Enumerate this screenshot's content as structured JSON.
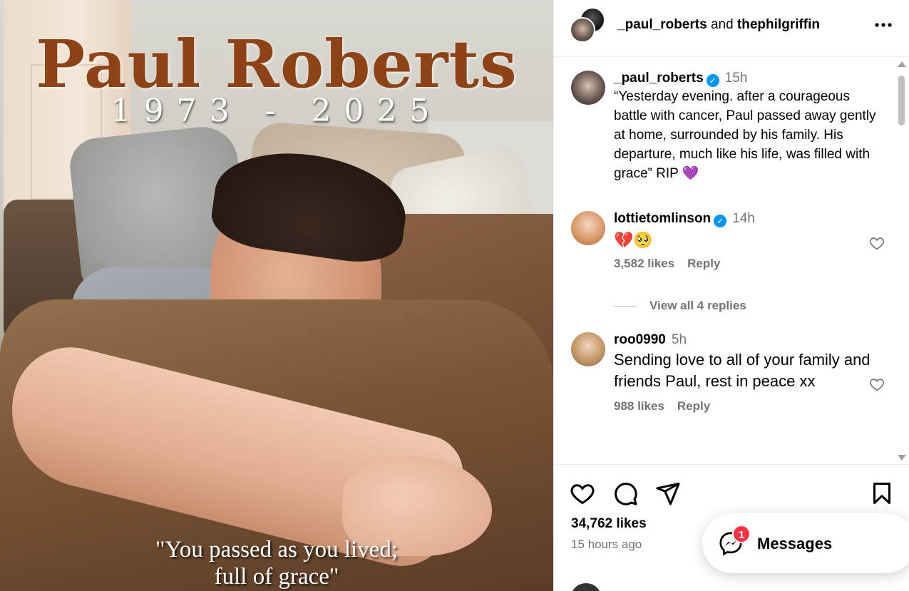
{
  "post": {
    "overlay_name": "Paul Roberts",
    "overlay_years": "1973 - 2025",
    "overlay_quote_line1": "\"You passed as you lived;",
    "overlay_quote_line2": "full of grace\""
  },
  "header": {
    "user1": "_paul_roberts",
    "joiner": "and",
    "user2": "thephilgriffin",
    "more_icon": "more-horizontal-icon"
  },
  "caption": {
    "user": "_paul_roberts",
    "verified": true,
    "time": "15h",
    "text": "“Yesterday evening. after a courageous battle with cancer, Paul passed away gently at home, surrounded by his family. His departure, much like his life, was filled with grace” RIP 💜"
  },
  "comments": [
    {
      "user": "lottietomlinson",
      "verified": true,
      "time": "14h",
      "text": "💔🥺",
      "likes": "3,582 likes",
      "reply": "Reply",
      "view_replies": "View all 4 replies"
    },
    {
      "user": "roo0990",
      "verified": false,
      "time": "5h",
      "text": "Sending love to all of your family and friends Paul, rest in peace xx",
      "likes": "988 likes",
      "reply": "Reply"
    }
  ],
  "actions": {
    "icons": [
      "heart-icon",
      "comment-icon",
      "share-icon",
      "bookmark-icon"
    ],
    "likes": "34,762 likes",
    "time_ago": "15 hours ago"
  },
  "messages": {
    "label": "Messages",
    "badge": "1"
  },
  "colors": {
    "accent_blue": "#0095f6",
    "badge_red": "#ff3040",
    "muted_text": "#737373",
    "overlay_name": "#8d4315"
  }
}
